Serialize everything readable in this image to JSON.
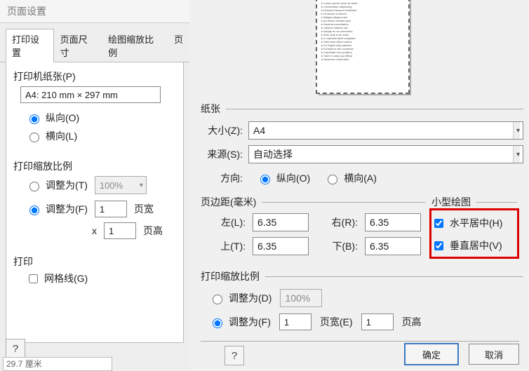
{
  "left": {
    "title": "页面设置",
    "tabs": {
      "print_setup": "打印设置",
      "page_size": "页面尺寸",
      "scale": "绘图缩放比例",
      "extra": "页"
    },
    "printer_paper_label": "打印机纸张(P)",
    "paper_value": "A4:  210 mm × 297 mm",
    "orientation": {
      "portrait": "纵向(O)",
      "landscape": "横向(L)"
    },
    "print_scale_label": "打印缩放比例",
    "adjust_t": "调整为(T)",
    "adjust_f": "调整为(F)",
    "scale_value": "100%",
    "fit_pages_wide": "1",
    "fit_pages_tall": "1",
    "pages_wide_label": "页宽",
    "pages_tall_label": "页高",
    "x_label": "x",
    "print_label": "打印",
    "gridlines": "网格线(G)",
    "footer_text": "29.7 厘米"
  },
  "right": {
    "paper": {
      "legend": "纸张",
      "size_label": "大小(Z):",
      "size_value": "A4",
      "source_label": "来源(S):",
      "source_value": "自动选择",
      "orientation_label": "方向:",
      "portrait": "纵向(O)",
      "landscape": "横向(A)"
    },
    "margins": {
      "legend": "页边距(毫米)",
      "left_label": "左(L):",
      "right_label": "右(R):",
      "top_label": "上(T):",
      "bottom_label": "下(B):",
      "left": "6.35",
      "right": "6.35",
      "top": "6.35",
      "bottom": "6.35"
    },
    "small": {
      "legend": "小型绘图",
      "hcenter": "水平居中(H)",
      "vcenter": "垂直居中(V)"
    },
    "scale": {
      "legend": "打印缩放比例",
      "adjust_d": "调整为(D)",
      "adjust_f": "调整为(F)",
      "scale_value": "100%",
      "fit_w": "1",
      "fit_h": "1",
      "wide_label": "页宽(E)",
      "tall_label": "页高"
    },
    "buttons": {
      "ok": "确定",
      "cancel": "取消"
    }
  }
}
